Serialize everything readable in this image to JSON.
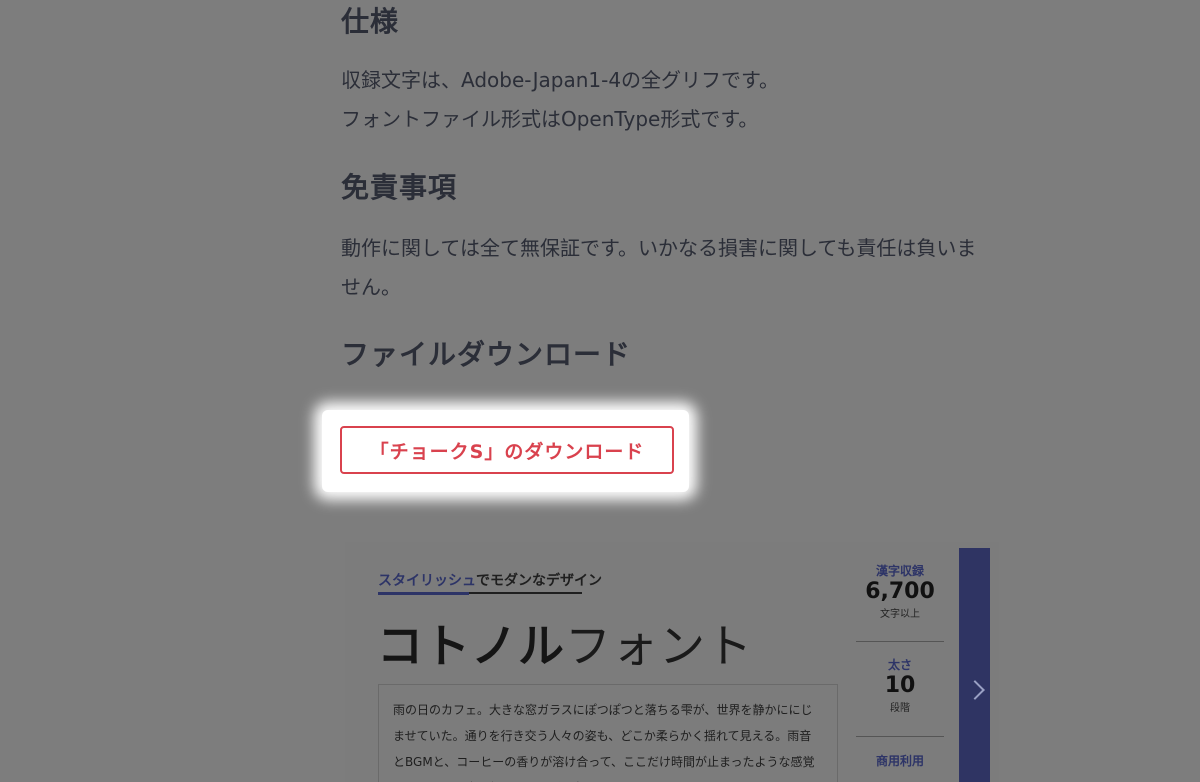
{
  "sections": {
    "spec": {
      "heading": "仕様",
      "line1": "収録文字は、Adobe-Japan1-4の全グリフです。",
      "line2": "フォントファイル形式はOpenType形式です。"
    },
    "disclaimer": {
      "heading": "免責事項",
      "line1": "動作に関しては全て無保証です。いかなる損害に関しても責任は負いま",
      "line2": "せん。"
    },
    "download": {
      "heading": "ファイルダウンロード",
      "button_label": "「チョークS」のダウンロード"
    }
  },
  "banner": {
    "tagline_accent": "スタイリッシュ",
    "tagline_rest": "でモダンなデザイン",
    "font_name_bold": "コトノル",
    "font_name_thin": "フォント",
    "sample_text": "雨の日のカフェ。大きな窓ガラスにぽつぽつと落ちる雫が、世界を静かににじませていた。通りを行き交う人々の姿も、どこか柔らかく揺れて見える。雨音とBGMと、コーヒーの香りが溶け合って、ここだけ時間が止まったような感覚になる。雨は止む気配を見せず、空はどこまで",
    "stats": [
      {
        "label": "漢字収録",
        "value": "6,700",
        "unit": "文字以上"
      },
      {
        "label": "太さ",
        "value": "10",
        "unit": "段階"
      },
      {
        "label": "商用利用",
        "value": "",
        "unit": ""
      }
    ],
    "next_icon": "chevron-right-icon"
  },
  "colors": {
    "accent_red": "#d9424e",
    "navy": "#2d3467",
    "overlay_gray": "#7d7d7d"
  }
}
